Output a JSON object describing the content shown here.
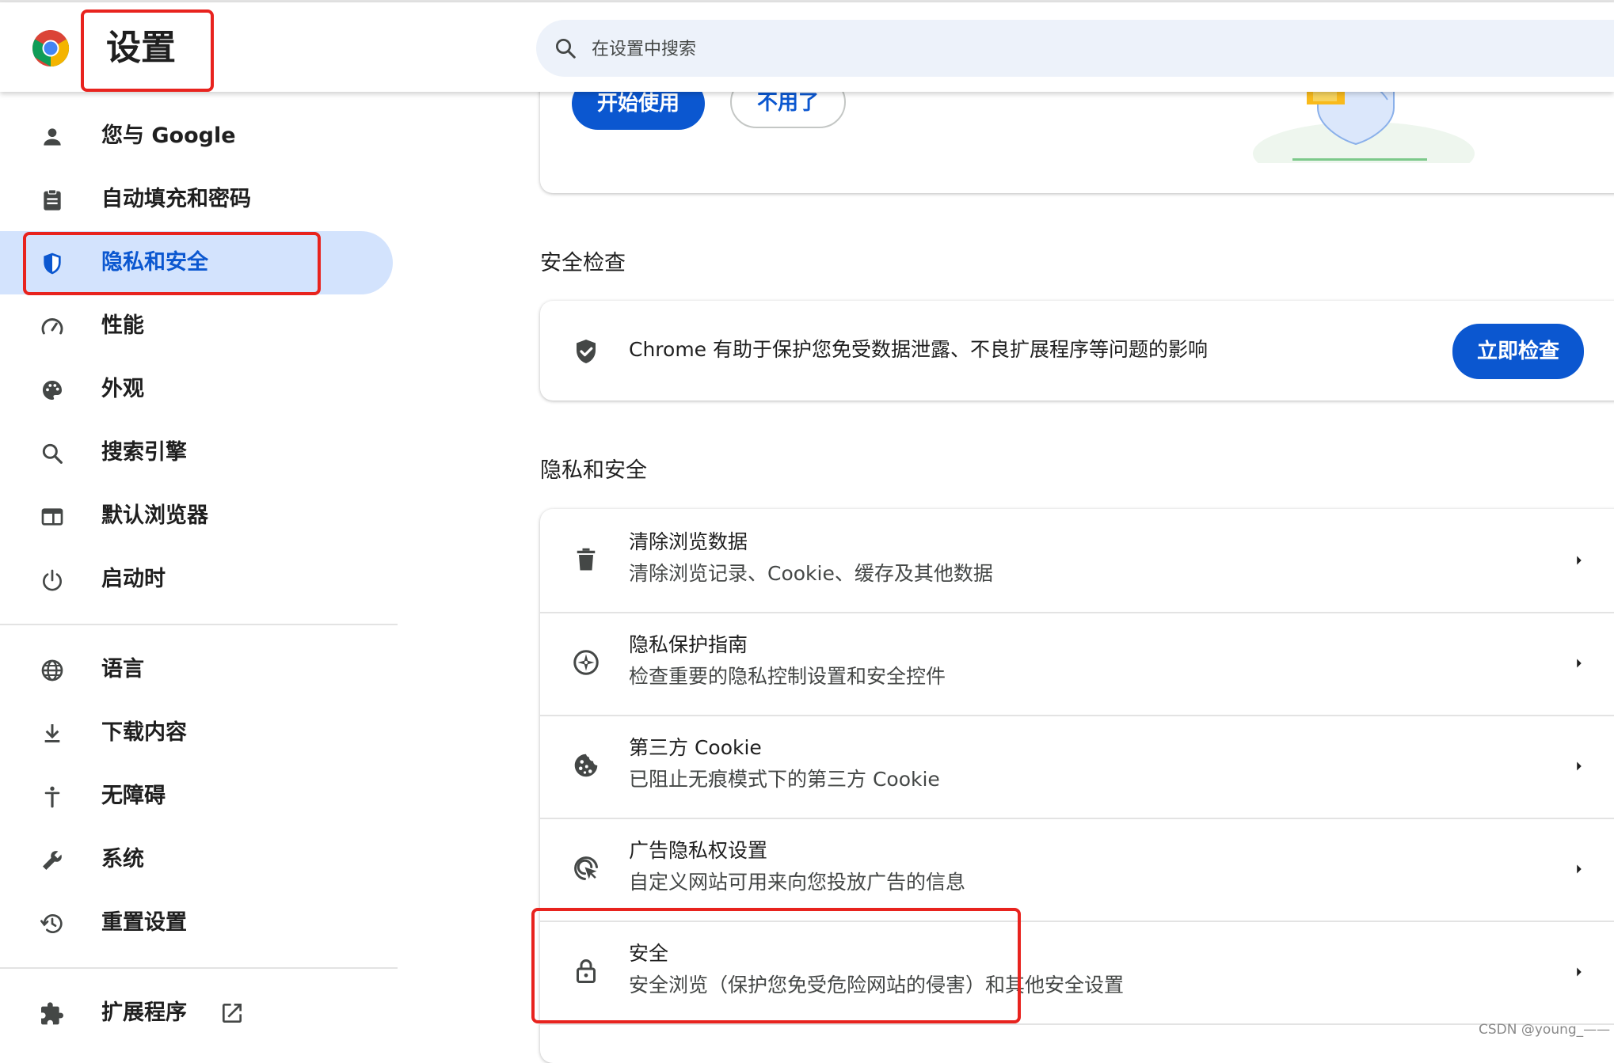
{
  "header": {
    "app_title": "设置",
    "search_placeholder": "在设置中搜索"
  },
  "sidebar": {
    "items": [
      {
        "label": "您与 Google",
        "icon": "person-icon"
      },
      {
        "label": "自动填充和密码",
        "icon": "clipboard-icon"
      },
      {
        "label": "隐私和安全",
        "icon": "shield-icon",
        "active": true
      },
      {
        "label": "性能",
        "icon": "speedometer-icon"
      },
      {
        "label": "外观",
        "icon": "palette-icon"
      },
      {
        "label": "搜索引擎",
        "icon": "search-icon"
      },
      {
        "label": "默认浏览器",
        "icon": "browser-window-icon"
      },
      {
        "label": "启动时",
        "icon": "power-icon"
      },
      {
        "label": "语言",
        "icon": "globe-icon"
      },
      {
        "label": "下载内容",
        "icon": "download-icon"
      },
      {
        "label": "无障碍",
        "icon": "accessibility-icon"
      },
      {
        "label": "系统",
        "icon": "wrench-icon"
      },
      {
        "label": "重置设置",
        "icon": "history-icon"
      },
      {
        "label": "扩展程序",
        "icon": "puzzle-icon"
      }
    ],
    "extensions_link_icon": "open-in-new-icon"
  },
  "promo_card": {
    "start_button": "开始使用",
    "dismiss_button": "不用了"
  },
  "safety_check": {
    "section_title": "安全检查",
    "description": "Chrome 有助于保护您免受数据泄露、不良扩展程序等问题的影响",
    "button": "立即检查"
  },
  "privacy": {
    "section_title": "隐私和安全",
    "rows": [
      {
        "title": "清除浏览数据",
        "subtitle": "清除浏览记录、Cookie、缓存及其他数据",
        "icon": "trash-icon"
      },
      {
        "title": "隐私保护指南",
        "subtitle": "检查重要的隐私控制设置和安全控件",
        "icon": "compass-icon"
      },
      {
        "title": "第三方 Cookie",
        "subtitle": "已阻止无痕模式下的第三方 Cookie",
        "icon": "cookie-icon"
      },
      {
        "title": "广告隐私权设置",
        "subtitle": "自定义网站可用来向您投放广告的信息",
        "icon": "ad-privacy-icon"
      },
      {
        "title": "安全",
        "subtitle": "安全浏览（保护您免受危险网站的侵害）和其他安全设置",
        "icon": "lock-icon"
      }
    ]
  },
  "watermark": "CSDN @young_——",
  "colors": {
    "accent": "#0b57d0",
    "active_nav_bg": "#d3e3fd",
    "search_bg": "#edf2fa",
    "highlight_red": "#e8231e"
  }
}
